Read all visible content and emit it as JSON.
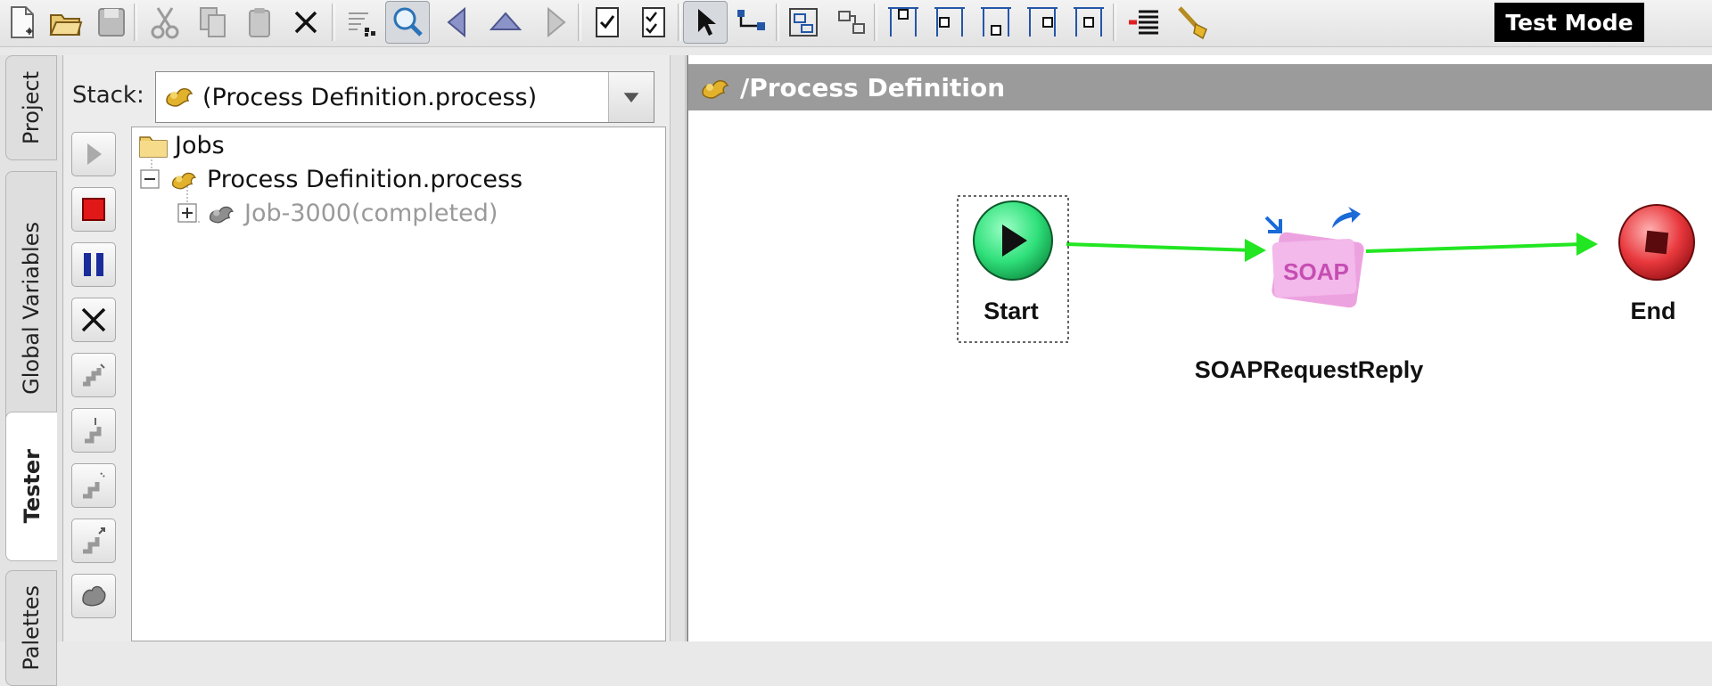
{
  "toolbar": {
    "buttons": [
      {
        "name": "new-file",
        "icon": "new-document-icon"
      },
      {
        "name": "open",
        "icon": "open-folder-icon"
      },
      {
        "name": "save",
        "icon": "save-disk-icon"
      },
      {
        "name": "cut",
        "icon": "scissors-icon"
      },
      {
        "name": "copy",
        "icon": "copy-icon"
      },
      {
        "name": "paste",
        "icon": "clipboard-icon"
      },
      {
        "name": "delete",
        "icon": "close-icon"
      },
      {
        "name": "zoom-fit",
        "icon": "zoom-fit-icon"
      },
      {
        "name": "find",
        "icon": "magnifier-icon"
      },
      {
        "name": "back",
        "icon": "triangle-left-icon"
      },
      {
        "name": "up",
        "icon": "triangle-up-icon"
      },
      {
        "name": "forward",
        "icon": "triangle-right-icon"
      },
      {
        "name": "validate",
        "icon": "checklist-icon"
      },
      {
        "name": "validate-all",
        "icon": "double-checklist-icon"
      },
      {
        "name": "select-tool",
        "icon": "arrow-pointer-icon"
      },
      {
        "name": "transition-tool",
        "icon": "transition-icon"
      },
      {
        "name": "group",
        "icon": "group-icon"
      },
      {
        "name": "layout",
        "icon": "layout-icon"
      },
      {
        "name": "align-top",
        "icon": "align-top-icon"
      },
      {
        "name": "align-left",
        "icon": "align-left-icon"
      },
      {
        "name": "align-bottom",
        "icon": "align-bottom-icon"
      },
      {
        "name": "align-right",
        "icon": "align-right-icon"
      },
      {
        "name": "align-center",
        "icon": "align-center-icon"
      },
      {
        "name": "breakpoints",
        "icon": "breakpoint-list-icon"
      },
      {
        "name": "test-tool",
        "icon": "test-wand-icon"
      }
    ],
    "test_mode_label": "Test Mode"
  },
  "left_tabs": [
    {
      "label": "Project",
      "active": false
    },
    {
      "label": "Global Variables",
      "active": false
    },
    {
      "label": "Tester",
      "active": true
    },
    {
      "label": "Palettes",
      "active": false
    }
  ],
  "tester": {
    "stack_label": "Stack:",
    "stack_value": "(Process Definition.process)",
    "controls": [
      {
        "name": "run",
        "icon": "play-icon"
      },
      {
        "name": "stop",
        "icon": "stop-icon"
      },
      {
        "name": "pause",
        "icon": "pause-icon"
      },
      {
        "name": "terminate",
        "icon": "close-icon"
      },
      {
        "name": "step-over",
        "icon": "step-over-icon"
      },
      {
        "name": "step-into",
        "icon": "step-into-icon"
      },
      {
        "name": "step-out",
        "icon": "step-out-icon"
      },
      {
        "name": "step-back",
        "icon": "step-back-icon"
      },
      {
        "name": "job",
        "icon": "job-gear-icon"
      }
    ],
    "tree": {
      "root": "Jobs",
      "process": "Process Definition.process",
      "job": "Job-3000(completed)"
    }
  },
  "canvas": {
    "title": "/Process Definition",
    "nodes": {
      "start": "Start",
      "soap": "SOAPRequestReply",
      "soap_badge": "SOAP",
      "end": "End"
    }
  },
  "colors": {
    "transition": "#22e622",
    "start": "#2fe07a",
    "end": "#e8383d",
    "header": "#9b9b9b",
    "soap": "#e98bd6"
  }
}
